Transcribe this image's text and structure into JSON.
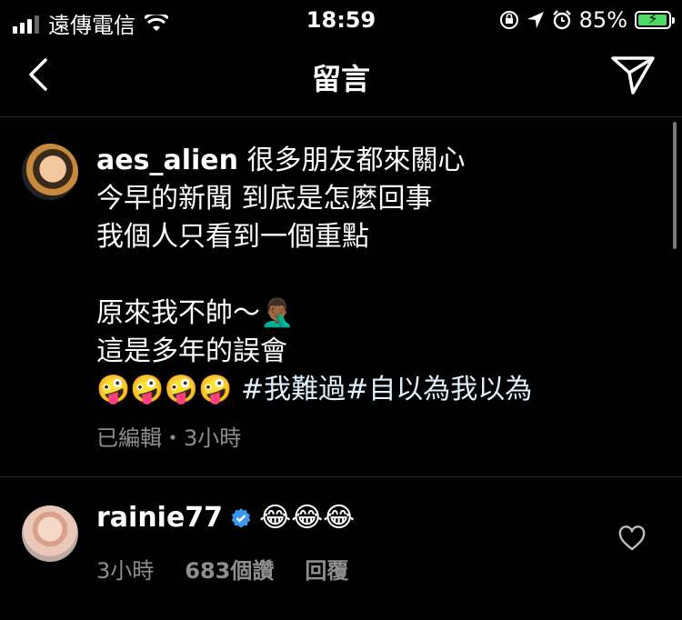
{
  "status_bar": {
    "carrier": "遠傳電信",
    "time": "18:59",
    "battery": "85%",
    "icons": [
      "signal-icon",
      "wifi-icon",
      "orientation-lock-icon",
      "location-icon",
      "alarm-icon",
      "battery-icon"
    ]
  },
  "header": {
    "title": "留言",
    "back_icon": "chevron-left-icon",
    "send_icon": "paper-plane-icon"
  },
  "post": {
    "username": "aes_alien",
    "lines": [
      "很多朋友都來關心",
      "今早的新聞 到底是怎麼回事",
      "我個人只看到一個重點",
      "",
      "原來我不帥～🤦🏾‍♂️",
      "這是多年的誤會",
      "🤪🤪🤪🤪",
      "#我難過#自以為我以為"
    ],
    "meta": "已編輯・3小時"
  },
  "comment": {
    "username": "rainie77",
    "text": "😂😂😂",
    "time": "3小時",
    "likes": "683個讚",
    "reply": "回覆"
  },
  "colors": {
    "background": "#000000",
    "text": "#ffffff",
    "secondary": "#8e8e8e",
    "verified": "#3897f0",
    "battery_fill": "#4cd964"
  }
}
